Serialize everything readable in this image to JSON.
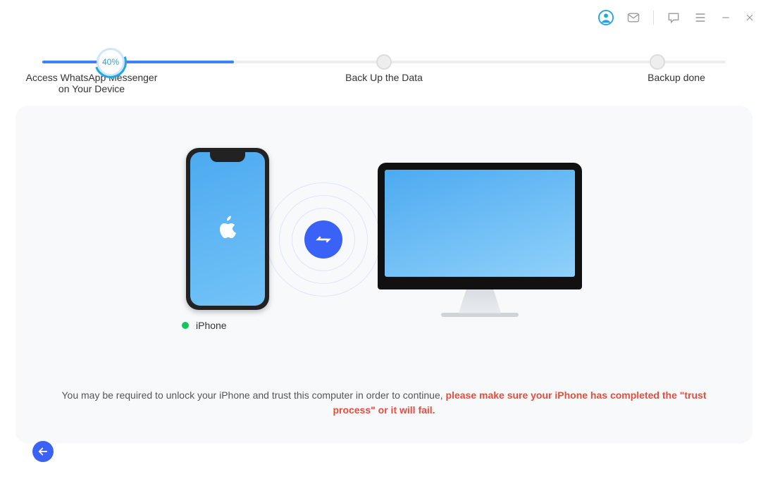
{
  "progress": {
    "percent_label": "40%",
    "fill_percent": 28,
    "steps": [
      {
        "label": "Access WhatsApp Messenger\non Your Device",
        "pos": 10
      },
      {
        "label": "Back Up the Data",
        "pos": 50
      },
      {
        "label": "Backup done",
        "pos": 90
      }
    ]
  },
  "device": {
    "name": "iPhone",
    "status_color": "#15c45a"
  },
  "hint": {
    "pre": "You may be required to unlock your iPhone and trust this computer in order to continue, ",
    "warn": "please make sure your iPhone has completed the \"trust process\" or it will fail."
  }
}
